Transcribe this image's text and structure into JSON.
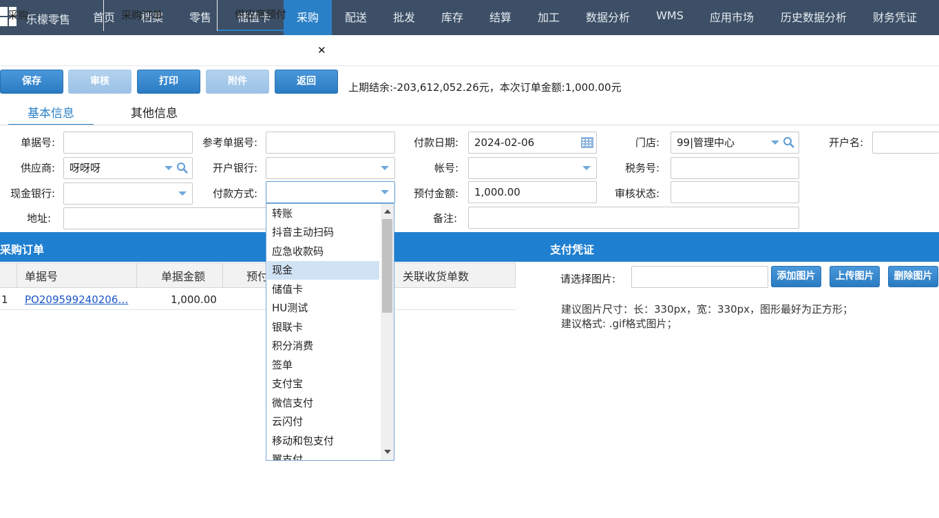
{
  "nav": {
    "brand": "乐檬零售",
    "items": [
      {
        "label": "首页"
      },
      {
        "label": "档案"
      },
      {
        "label": "零售"
      },
      {
        "label": "储值卡"
      },
      {
        "label": "采购",
        "active": true
      },
      {
        "label": "配送"
      },
      {
        "label": "批发"
      },
      {
        "label": "库存"
      },
      {
        "label": "结算"
      },
      {
        "label": "加工"
      },
      {
        "label": "数据分析"
      },
      {
        "label": "WMS"
      },
      {
        "label": "应用市场"
      },
      {
        "label": "历史数据分析"
      },
      {
        "label": "财务凭证"
      }
    ]
  },
  "tabs": [
    {
      "label": "采购"
    },
    {
      "label": "采购订单"
    },
    {
      "label": "供应商预付",
      "active": true
    }
  ],
  "toolbar": {
    "save": "保存",
    "audit": "审核",
    "print": "打印",
    "attach": "附件",
    "back": "返回",
    "summary": "上期结余:-203,612,052.26元，本次订单金额:1,000.00元"
  },
  "info_tabs": {
    "basic": "基本信息",
    "other": "其他信息"
  },
  "form": {
    "doc_no": {
      "label": "单据号:",
      "value": ""
    },
    "ref_no": {
      "label": "参考单据号:",
      "value": ""
    },
    "pay_date": {
      "label": "付款日期:",
      "value": "2024-02-06"
    },
    "store": {
      "label": "门店:",
      "value": "99|管理中心"
    },
    "account_name": {
      "label": "开户名:",
      "value": ""
    },
    "supplier": {
      "label": "供应商:",
      "value": "呀呀呀"
    },
    "bank": {
      "label": "开户银行:",
      "value": ""
    },
    "account_no": {
      "label": "帐号:",
      "value": ""
    },
    "tax_no": {
      "label": "税务号:",
      "value": ""
    },
    "cash_bank": {
      "label": "现金银行:",
      "value": ""
    },
    "pay_method": {
      "label": "付款方式:",
      "value": ""
    },
    "prepay_amount": {
      "label": "预付金额:",
      "value": "1,000.00"
    },
    "audit_status": {
      "label": "审核状态:",
      "value": ""
    },
    "address": {
      "label": "地址:",
      "value": ""
    },
    "remark": {
      "label": "备注:",
      "value": ""
    }
  },
  "orders": {
    "title": "采购订单",
    "columns": [
      "单据号",
      "单据金额",
      "预付",
      "关联收货单数"
    ],
    "rows": [
      {
        "index": "1",
        "doc_no": "PO209599240206…",
        "amount": "1,000.00"
      }
    ]
  },
  "voucher": {
    "title": "支付凭证",
    "select_label": "请选择图片:",
    "add": "添加图片",
    "upload": "上传图片",
    "delete": "删除图片",
    "tip1": "建议图片尺寸：长：330px，宽：330px，图形最好为正方形；",
    "tip2": "建议格式: .gif格式图片；"
  },
  "pay_method_options": {
    "selected": "现金",
    "items": [
      "转账",
      "抖音主动扫码",
      "应急收款码",
      "现金",
      "储值卡",
      "HU测试",
      "银联卡",
      "积分消费",
      "签单",
      "支付宝",
      "微信支付",
      "云闪付",
      "移动和包支付",
      "翼支付"
    ]
  },
  "colors": {
    "nav_bg": "#3c4f66",
    "accent": "#2a80c7",
    "section_bar": "#1f7fd0"
  }
}
